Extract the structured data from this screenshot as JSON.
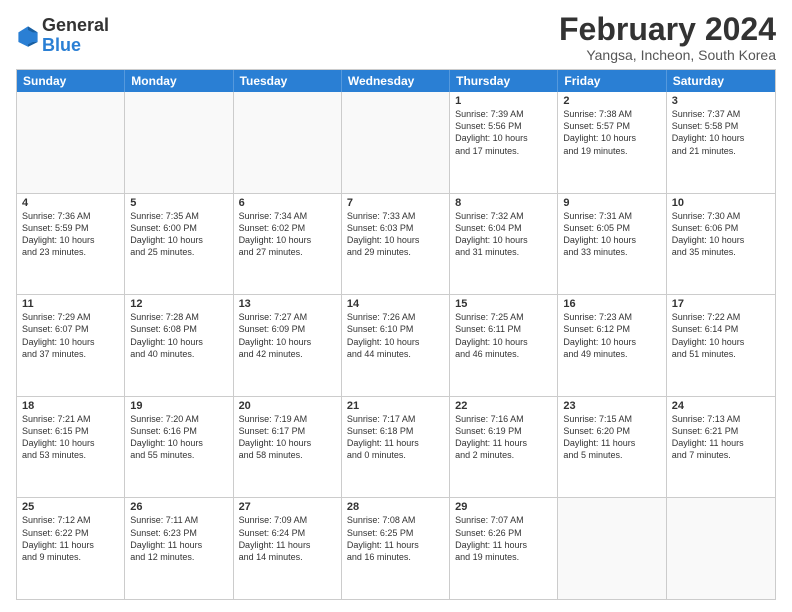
{
  "header": {
    "logo_general": "General",
    "logo_blue": "Blue",
    "title": "February 2024",
    "subtitle": "Yangsa, Incheon, South Korea"
  },
  "days": [
    "Sunday",
    "Monday",
    "Tuesday",
    "Wednesday",
    "Thursday",
    "Friday",
    "Saturday"
  ],
  "rows": [
    [
      {
        "day": "",
        "info": "",
        "empty": true
      },
      {
        "day": "",
        "info": "",
        "empty": true
      },
      {
        "day": "",
        "info": "",
        "empty": true
      },
      {
        "day": "",
        "info": "",
        "empty": true
      },
      {
        "day": "1",
        "info": "Sunrise: 7:39 AM\nSunset: 5:56 PM\nDaylight: 10 hours\nand 17 minutes."
      },
      {
        "day": "2",
        "info": "Sunrise: 7:38 AM\nSunset: 5:57 PM\nDaylight: 10 hours\nand 19 minutes."
      },
      {
        "day": "3",
        "info": "Sunrise: 7:37 AM\nSunset: 5:58 PM\nDaylight: 10 hours\nand 21 minutes."
      }
    ],
    [
      {
        "day": "4",
        "info": "Sunrise: 7:36 AM\nSunset: 5:59 PM\nDaylight: 10 hours\nand 23 minutes."
      },
      {
        "day": "5",
        "info": "Sunrise: 7:35 AM\nSunset: 6:00 PM\nDaylight: 10 hours\nand 25 minutes."
      },
      {
        "day": "6",
        "info": "Sunrise: 7:34 AM\nSunset: 6:02 PM\nDaylight: 10 hours\nand 27 minutes."
      },
      {
        "day": "7",
        "info": "Sunrise: 7:33 AM\nSunset: 6:03 PM\nDaylight: 10 hours\nand 29 minutes."
      },
      {
        "day": "8",
        "info": "Sunrise: 7:32 AM\nSunset: 6:04 PM\nDaylight: 10 hours\nand 31 minutes."
      },
      {
        "day": "9",
        "info": "Sunrise: 7:31 AM\nSunset: 6:05 PM\nDaylight: 10 hours\nand 33 minutes."
      },
      {
        "day": "10",
        "info": "Sunrise: 7:30 AM\nSunset: 6:06 PM\nDaylight: 10 hours\nand 35 minutes."
      }
    ],
    [
      {
        "day": "11",
        "info": "Sunrise: 7:29 AM\nSunset: 6:07 PM\nDaylight: 10 hours\nand 37 minutes."
      },
      {
        "day": "12",
        "info": "Sunrise: 7:28 AM\nSunset: 6:08 PM\nDaylight: 10 hours\nand 40 minutes."
      },
      {
        "day": "13",
        "info": "Sunrise: 7:27 AM\nSunset: 6:09 PM\nDaylight: 10 hours\nand 42 minutes."
      },
      {
        "day": "14",
        "info": "Sunrise: 7:26 AM\nSunset: 6:10 PM\nDaylight: 10 hours\nand 44 minutes."
      },
      {
        "day": "15",
        "info": "Sunrise: 7:25 AM\nSunset: 6:11 PM\nDaylight: 10 hours\nand 46 minutes."
      },
      {
        "day": "16",
        "info": "Sunrise: 7:23 AM\nSunset: 6:12 PM\nDaylight: 10 hours\nand 49 minutes."
      },
      {
        "day": "17",
        "info": "Sunrise: 7:22 AM\nSunset: 6:14 PM\nDaylight: 10 hours\nand 51 minutes."
      }
    ],
    [
      {
        "day": "18",
        "info": "Sunrise: 7:21 AM\nSunset: 6:15 PM\nDaylight: 10 hours\nand 53 minutes."
      },
      {
        "day": "19",
        "info": "Sunrise: 7:20 AM\nSunset: 6:16 PM\nDaylight: 10 hours\nand 55 minutes."
      },
      {
        "day": "20",
        "info": "Sunrise: 7:19 AM\nSunset: 6:17 PM\nDaylight: 10 hours\nand 58 minutes."
      },
      {
        "day": "21",
        "info": "Sunrise: 7:17 AM\nSunset: 6:18 PM\nDaylight: 11 hours\nand 0 minutes."
      },
      {
        "day": "22",
        "info": "Sunrise: 7:16 AM\nSunset: 6:19 PM\nDaylight: 11 hours\nand 2 minutes."
      },
      {
        "day": "23",
        "info": "Sunrise: 7:15 AM\nSunset: 6:20 PM\nDaylight: 11 hours\nand 5 minutes."
      },
      {
        "day": "24",
        "info": "Sunrise: 7:13 AM\nSunset: 6:21 PM\nDaylight: 11 hours\nand 7 minutes."
      }
    ],
    [
      {
        "day": "25",
        "info": "Sunrise: 7:12 AM\nSunset: 6:22 PM\nDaylight: 11 hours\nand 9 minutes."
      },
      {
        "day": "26",
        "info": "Sunrise: 7:11 AM\nSunset: 6:23 PM\nDaylight: 11 hours\nand 12 minutes."
      },
      {
        "day": "27",
        "info": "Sunrise: 7:09 AM\nSunset: 6:24 PM\nDaylight: 11 hours\nand 14 minutes."
      },
      {
        "day": "28",
        "info": "Sunrise: 7:08 AM\nSunset: 6:25 PM\nDaylight: 11 hours\nand 16 minutes."
      },
      {
        "day": "29",
        "info": "Sunrise: 7:07 AM\nSunset: 6:26 PM\nDaylight: 11 hours\nand 19 minutes."
      },
      {
        "day": "",
        "info": "",
        "empty": true
      },
      {
        "day": "",
        "info": "",
        "empty": true
      }
    ]
  ]
}
